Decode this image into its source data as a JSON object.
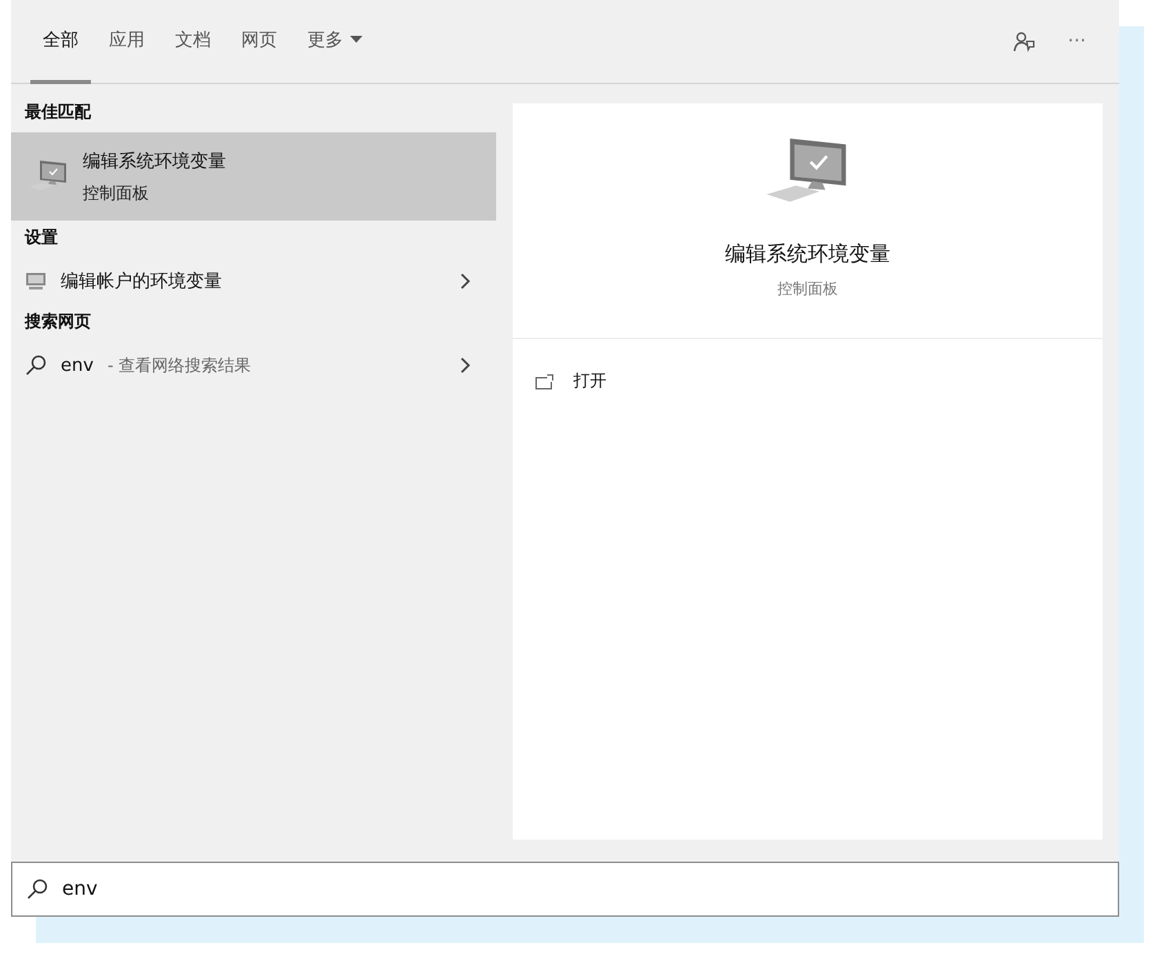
{
  "tabs": [
    {
      "label": "全部",
      "selected": true,
      "kind": "plain"
    },
    {
      "label": "应用",
      "selected": false,
      "kind": "plain"
    },
    {
      "label": "文档",
      "selected": false,
      "kind": "plain"
    },
    {
      "label": "网页",
      "selected": false,
      "kind": "plain"
    },
    {
      "label": "更多",
      "selected": false,
      "kind": "dropdown"
    }
  ],
  "toolbar": {
    "more": "···"
  },
  "sections": [
    {
      "title": "最佳匹配",
      "items": [
        {
          "kind": "app",
          "title": "编辑系统环境变量",
          "subtitle": "控制面板",
          "selected": true
        }
      ]
    },
    {
      "title": "设置",
      "items": [
        {
          "kind": "setting",
          "title": "编辑帐户的环境变量",
          "selected": false
        }
      ]
    },
    {
      "title": "搜索网页",
      "items": [
        {
          "kind": "web",
          "title": "env",
          "hint": "- 查看网络搜索结果",
          "selected": false
        }
      ]
    }
  ],
  "detail": {
    "title": "编辑系统环境变量",
    "subtitle": "控制面板",
    "actions": [
      {
        "label": "打开"
      }
    ]
  },
  "search": {
    "value": "env"
  }
}
